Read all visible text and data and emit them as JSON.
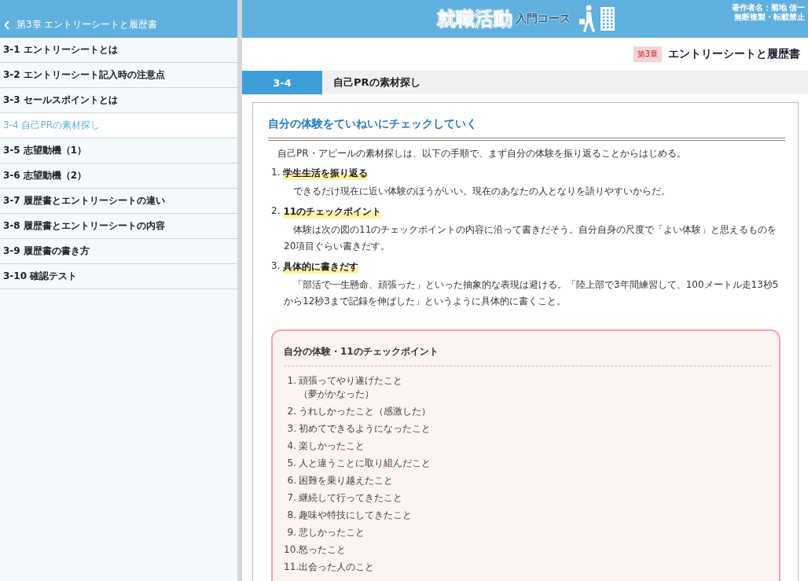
{
  "sidebar": {
    "back_label": "第3章 エントリーシートと履歴書",
    "items": [
      {
        "label": "3-1 エントリーシートとは",
        "selected": false
      },
      {
        "label": "3-2 エントリーシート記入時の注意点",
        "selected": false
      },
      {
        "label": "3-3 セールスポイントとは",
        "selected": false
      },
      {
        "label": "3-4 自己PRの素材探し",
        "selected": true
      },
      {
        "label": "3-5 志望動機（1）",
        "selected": false
      },
      {
        "label": "3-6 志望動機（2）",
        "selected": false
      },
      {
        "label": "3-7 履歴書とエントリーシートの違い",
        "selected": false
      },
      {
        "label": "3-8 履歴書とエントリーシートの内容",
        "selected": false
      },
      {
        "label": "3-9 履歴書の書き方",
        "selected": false
      },
      {
        "label": "3-10 確認テスト",
        "selected": false
      }
    ]
  },
  "header": {
    "logo_main": "就職活動",
    "logo_sub": "入門コース",
    "author": "著作者名：菊地 信一",
    "notice": "無断複製・転載禁止"
  },
  "chapter": {
    "badge": "第3章",
    "title": "エントリーシートと履歴書"
  },
  "section": {
    "number": "3-4",
    "title": "自己PRの素材探し"
  },
  "article": {
    "heading": "自分の体験をていねいにチェックしていく",
    "intro": "自己PR・アピールの素材探しは、以下の手順で、まず自分の体験を振り返ることからはじめる。",
    "steps": [
      {
        "number": "1.",
        "title": "学生生活を振り返る",
        "text": "できるだけ現在に近い体験のほうがいい。現在のあなたの人となりを語りやすいからだ。"
      },
      {
        "number": "2.",
        "title": "11のチェックポイント",
        "text": "体験は次の図の11のチェックポイントの内容に沿って書きだそう。自分自身の尺度で「よい体験」と思えるものを20項目ぐらい書きだす。"
      },
      {
        "number": "3.",
        "title": "具体的に書きだす",
        "text": "「部活で一生懸命、頑張った」といった抽象的な表現は避ける。「陸上部で3年間練習して、100メートル走13秒5から12秒3まで記録を伸ばした」というように具体的に書くこと。"
      }
    ],
    "checklist": {
      "title": "自分の体験・11のチェックポイント",
      "items": [
        {
          "number": "1.",
          "lines": [
            "頑張ってやり遂げたこと",
            "（夢がかなった）"
          ]
        },
        {
          "number": "2.",
          "lines": [
            "うれしかったこと（感激した）"
          ]
        },
        {
          "number": "3.",
          "lines": [
            "初めてできるようになったこと"
          ]
        },
        {
          "number": "4.",
          "lines": [
            "楽しかったこと"
          ]
        },
        {
          "number": "5.",
          "lines": [
            "人と違うことに取り組んだこと"
          ]
        },
        {
          "number": "6.",
          "lines": [
            "困難を乗り越えたこと"
          ]
        },
        {
          "number": "7.",
          "lines": [
            "継続して行ってきたこと"
          ]
        },
        {
          "number": "8.",
          "lines": [
            "趣味や特技にしてきたこと"
          ]
        },
        {
          "number": "9.",
          "lines": [
            "悲しかったこと"
          ]
        },
        {
          "number": "10.",
          "lines": [
            "怒ったこと"
          ]
        },
        {
          "number": "11.",
          "lines": [
            "出会った人のこと"
          ]
        }
      ]
    }
  }
}
